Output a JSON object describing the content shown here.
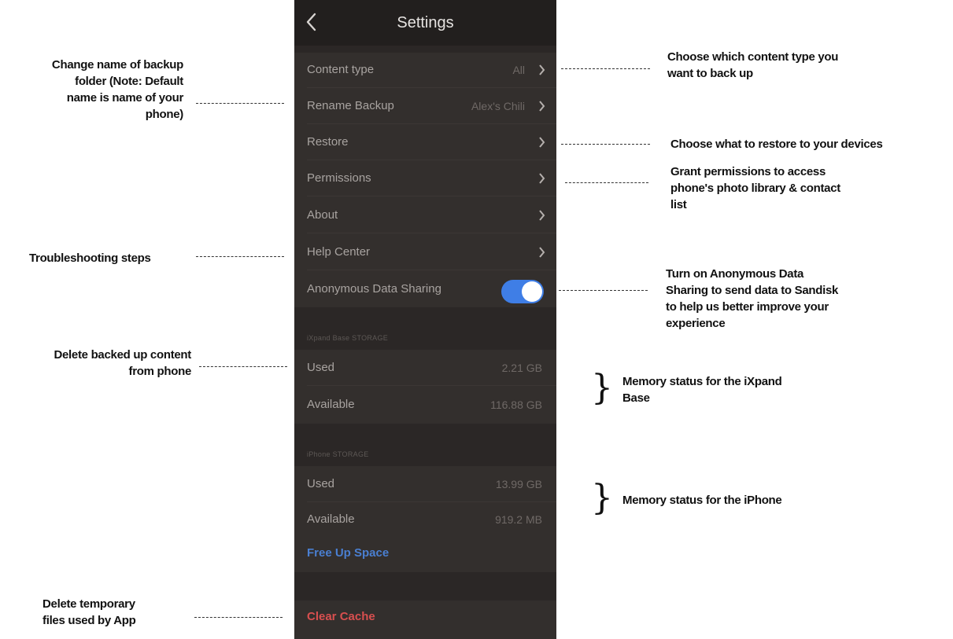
{
  "nav": {
    "title": "Settings",
    "back_icon": "chevron-left-icon"
  },
  "settings_rows": [
    {
      "label": "Content type",
      "value": "All"
    },
    {
      "label": "Rename Backup",
      "value": "Alex's Chili"
    },
    {
      "label": "Restore",
      "value": ""
    },
    {
      "label": "Permissions",
      "value": ""
    },
    {
      "label": "About",
      "value": ""
    },
    {
      "label": "Help Center",
      "value": ""
    },
    {
      "label": "Anonymous Data Sharing",
      "toggle": "on"
    }
  ],
  "ixpand_storage": {
    "header": "iXpand Base STORAGE",
    "used_label": "Used",
    "used_value": "2.21 GB",
    "available_label": "Available",
    "available_value": "116.88 GB"
  },
  "iphone_storage": {
    "header": "iPhone STORAGE",
    "used_label": "Used",
    "used_value": "13.99 GB",
    "available_label": "Available",
    "available_value": "919.2 MB",
    "free_up_label": "Free Up Space"
  },
  "clear_cache_label": "Clear Cache",
  "annotations": {
    "rename": [
      "Change name of backup",
      "folder (Note: Default",
      "name is name of your",
      "phone)"
    ],
    "content_type": [
      "Choose which content type you",
      "want to back up"
    ],
    "restore": "Choose what to restore to your devices",
    "permissions": [
      "Grant permissions to access",
      "phone's photo library & contact",
      "list"
    ],
    "help_center": "Troubleshooting steps",
    "data_sharing": [
      "Turn on Anonymous Data",
      "Sharing to send data to Sandisk",
      "to help us better improve your",
      "experience"
    ],
    "delete_backup": [
      "Delete backed up content",
      "from phone"
    ],
    "ixpand_memory": [
      "Memory status for the iXpand",
      "Base"
    ],
    "iphone_memory": "Memory status for the iPhone",
    "cache": [
      "Delete temporary",
      "files used by App"
    ]
  },
  "colors": {
    "phone_bg": "#2b2726",
    "toggle_on": "#3f7ee6",
    "free_up_link": "#4a7fd1",
    "clear_cache": "#d84f4f"
  }
}
